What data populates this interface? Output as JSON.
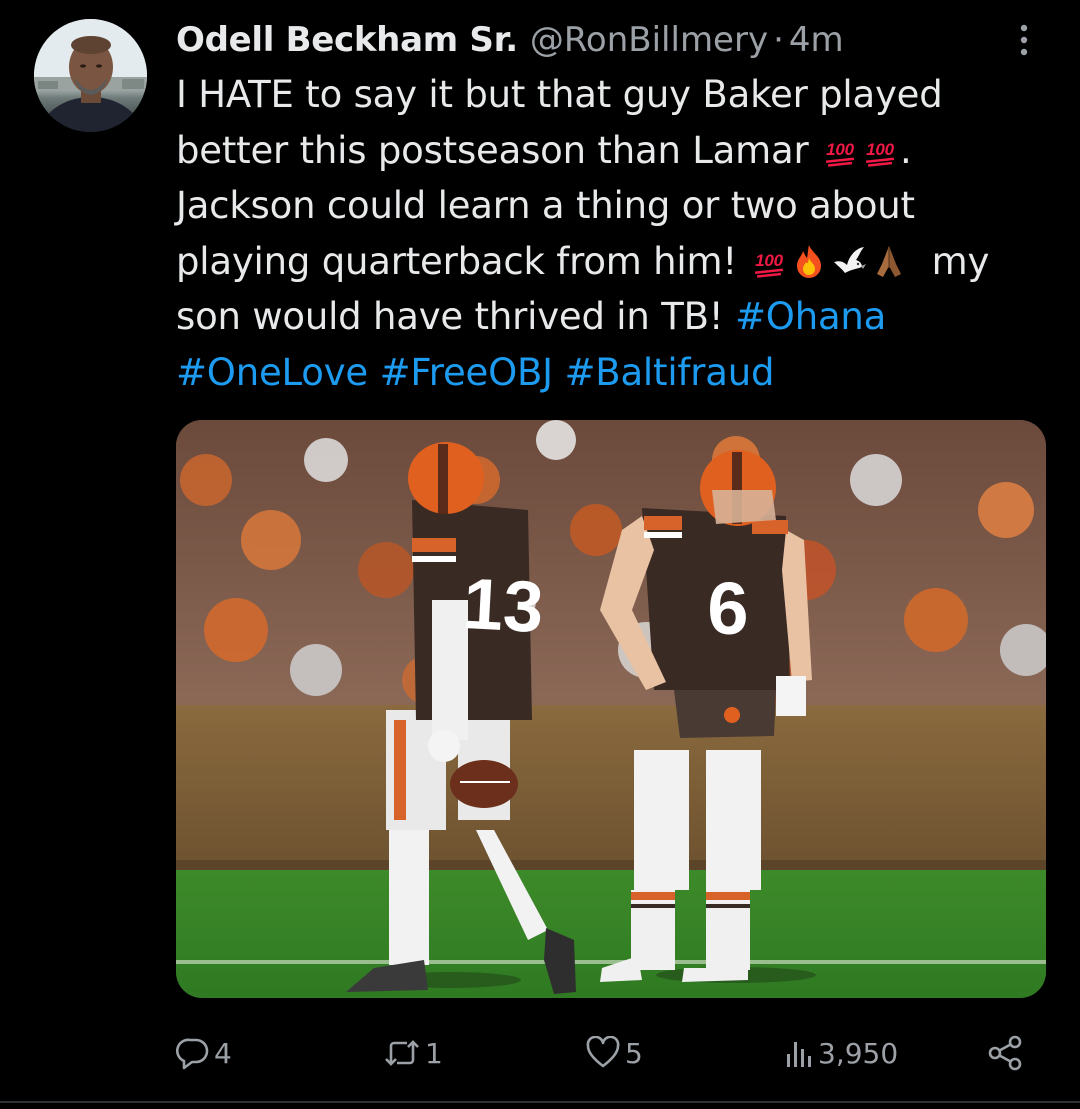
{
  "author": {
    "display_name": "Odell Beckham Sr.",
    "handle": "@RonBillmery",
    "separator": "·",
    "timestamp": "4m"
  },
  "tweet": {
    "lines": [
      [
        "I HATE to say it but that guy Baker played"
      ],
      [
        "better this postseason than Lamar ",
        "emoji:hundred-points",
        "emoji:hundred-points",
        "."
      ],
      [
        "Jackson could learn a thing or two about"
      ],
      [
        "playing quarterback from him! ",
        "emoji:hundred-points",
        "emoji:fire",
        "emoji:dove",
        "emoji:folded-hands",
        "  my"
      ],
      [
        "son would have thrived in TB! ",
        "hashtag:#Ohana"
      ],
      [
        "hashtag:#OneLove",
        " ",
        "hashtag:#FreeOBJ",
        " ",
        "hashtag:#Baltifraud"
      ]
    ]
  },
  "media": {
    "jersey_left": "13",
    "jersey_right": "6"
  },
  "actions": {
    "replies": "4",
    "retweets": "1",
    "likes": "5",
    "views": "3,950"
  },
  "colors": {
    "background": "#000000",
    "text": "#e7e9ea",
    "secondary": "#9ba1a6",
    "link": "#1d9bf0"
  },
  "icons": {
    "reply": "speech-bubble-icon",
    "retweet": "retweet-icon",
    "like": "heart-icon",
    "views": "bar-chart-icon",
    "share": "share-nodes-icon",
    "more": "vertical-ellipsis-icon"
  }
}
